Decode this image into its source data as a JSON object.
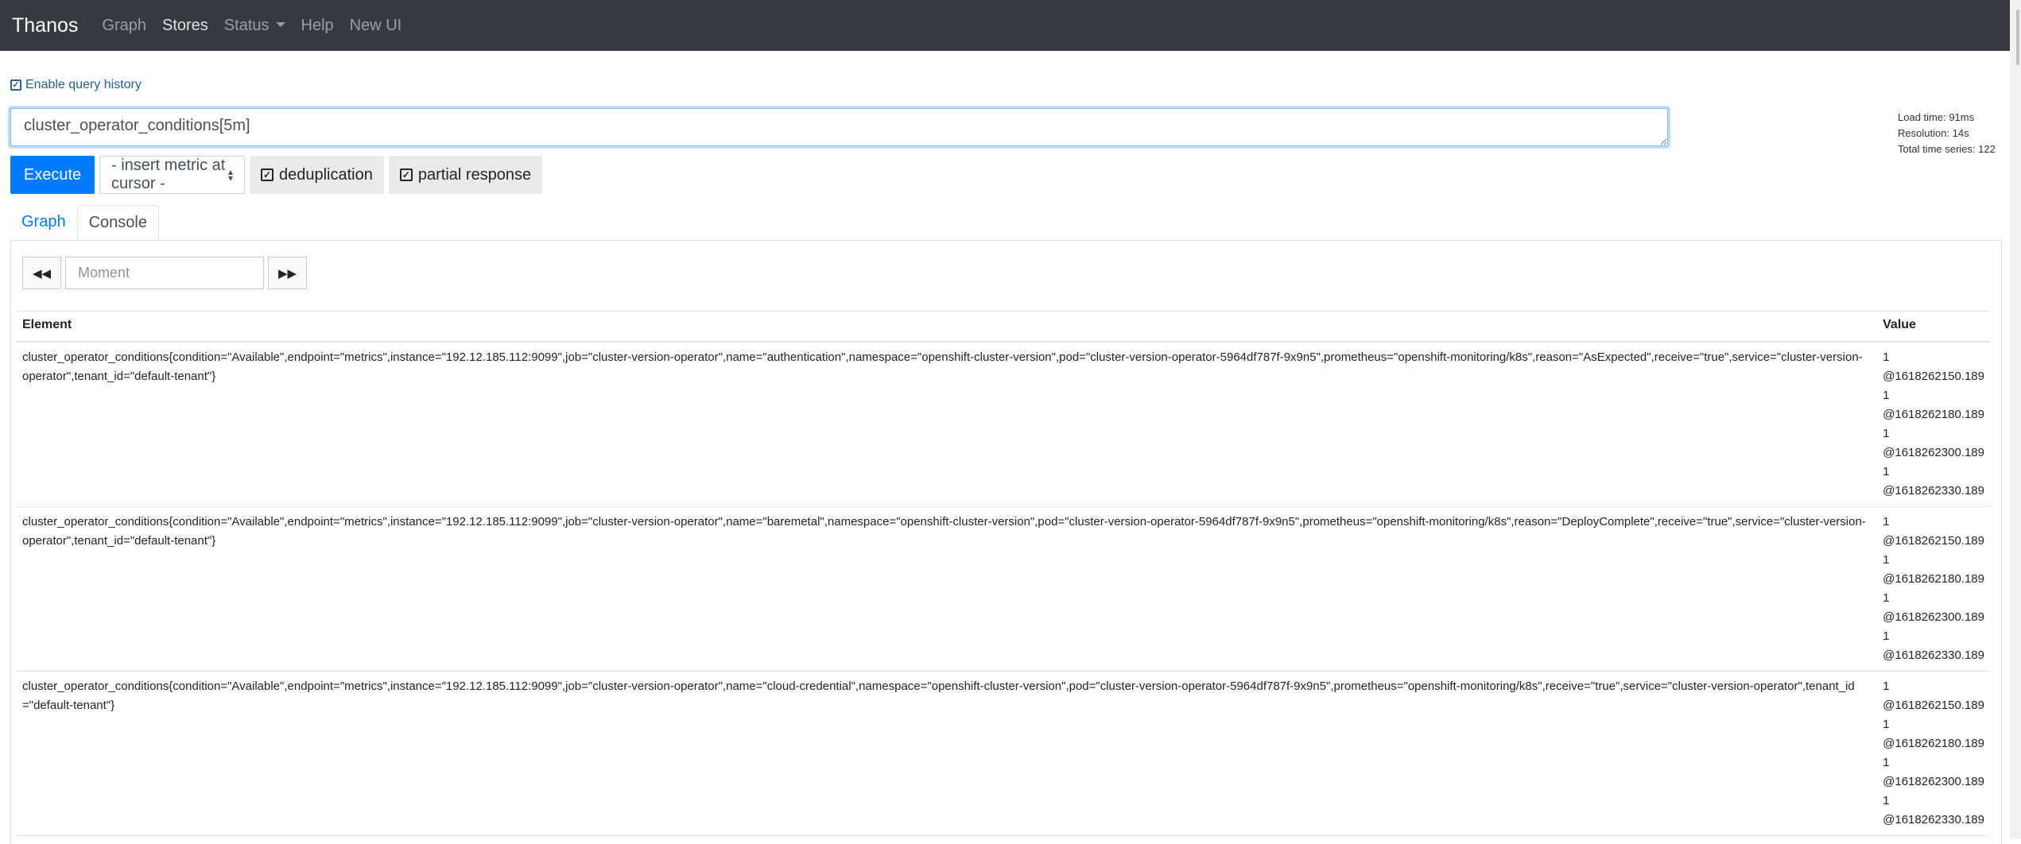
{
  "navbar": {
    "brand": "Thanos",
    "links": [
      {
        "label": "Graph",
        "active": false
      },
      {
        "label": "Stores",
        "active": true
      },
      {
        "label": "Status",
        "active": false,
        "dropdown": true
      },
      {
        "label": "Help",
        "active": false
      },
      {
        "label": "New UI",
        "active": false
      }
    ]
  },
  "query_history": {
    "label": "Enable query history",
    "checked": true
  },
  "query": {
    "value": "cluster_operator_conditions[5m]"
  },
  "stats": {
    "load_time": "Load time: 91ms",
    "resolution": "Resolution: 14s",
    "total_series": "Total time series: 122"
  },
  "toolbar": {
    "execute_label": "Execute",
    "metric_select": "- insert metric at cursor -",
    "deduplication_label": "deduplication",
    "deduplication_checked": true,
    "partial_response_label": "partial response",
    "partial_response_checked": true
  },
  "tabs": [
    {
      "label": "Graph",
      "active": false
    },
    {
      "label": "Console",
      "active": true
    }
  ],
  "console": {
    "moment_placeholder": "Moment",
    "back_icon": "double-chevron-left-icon",
    "forward_icon": "double-chevron-right-icon",
    "columns": [
      "Element",
      "Value"
    ],
    "rows": [
      {
        "element": "cluster_operator_conditions{condition=\"Available\",endpoint=\"metrics\",instance=\"192.12.185.112:9099\",job=\"cluster-version-operator\",name=\"authentication\",namespace=\"openshift-cluster-version\",pod=\"cluster-version-operator-5964df787f-9x9n5\",prometheus=\"openshift-monitoring/k8s\",reason=\"AsExpected\",receive=\"true\",service=\"cluster-version-operator\",tenant_id=\"default-tenant\"}",
        "values": [
          "1",
          "@1618262150.189",
          "1",
          "@1618262180.189",
          "1",
          "@1618262300.189",
          "1",
          "@1618262330.189"
        ]
      },
      {
        "element": "cluster_operator_conditions{condition=\"Available\",endpoint=\"metrics\",instance=\"192.12.185.112:9099\",job=\"cluster-version-operator\",name=\"baremetal\",namespace=\"openshift-cluster-version\",pod=\"cluster-version-operator-5964df787f-9x9n5\",prometheus=\"openshift-monitoring/k8s\",reason=\"DeployComplete\",receive=\"true\",service=\"cluster-version-operator\",tenant_id=\"default-tenant\"}",
        "values": [
          "1",
          "@1618262150.189",
          "1",
          "@1618262180.189",
          "1",
          "@1618262300.189",
          "1",
          "@1618262330.189"
        ]
      },
      {
        "element": "cluster_operator_conditions{condition=\"Available\",endpoint=\"metrics\",instance=\"192.12.185.112:9099\",job=\"cluster-version-operator\",name=\"cloud-credential\",namespace=\"openshift-cluster-version\",pod=\"cluster-version-operator-5964df787f-9x9n5\",prometheus=\"openshift-monitoring/k8s\",receive=\"true\",service=\"cluster-version-operator\",tenant_id=\"default-tenant\"}",
        "values": [
          "1",
          "@1618262150.189",
          "1",
          "@1618262180.189",
          "1",
          "@1618262300.189",
          "1",
          "@1618262330.189"
        ]
      }
    ]
  }
}
